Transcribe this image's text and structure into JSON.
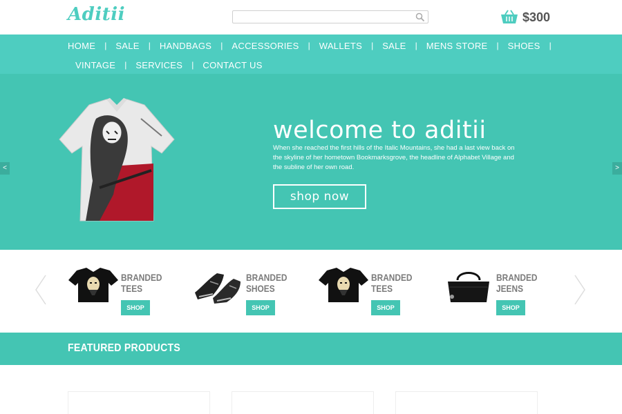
{
  "header": {
    "logo": "Aditii",
    "search": {
      "placeholder": "",
      "value": ""
    },
    "cart_amount": "$300"
  },
  "nav": {
    "row1": [
      "HOME",
      "SALE",
      "HANDBAGS",
      "ACCESSORIES",
      "WALLETS",
      "SALE",
      "MENS STORE",
      "SHOES"
    ],
    "row2": [
      "VINTAGE",
      "SERVICES",
      "CONTACT US"
    ]
  },
  "hero": {
    "title": "welcome to aditii",
    "text": "When she reached the first hills of the Italic Mountains, she had a last view back on the skyline of her hometown Bookmarksgrove, the headline of Alphabet Village and the subline of her own road.",
    "button": "shop now",
    "prev": "<",
    "next": ">"
  },
  "categories": [
    {
      "line1": "BRANDED",
      "line2": "TEES",
      "button": "SHOP"
    },
    {
      "line1": "BRANDED",
      "line2": "SHOES",
      "button": "SHOP"
    },
    {
      "line1": "BRANDED",
      "line2": "TEES",
      "button": "SHOP"
    },
    {
      "line1": "BRANDED",
      "line2": "JEENS",
      "button": "SHOP"
    }
  ],
  "featured": {
    "title": "FEATURED PRODUCTS"
  },
  "colors": {
    "accent": "#44c5b3",
    "nav": "#4ecdc0"
  }
}
